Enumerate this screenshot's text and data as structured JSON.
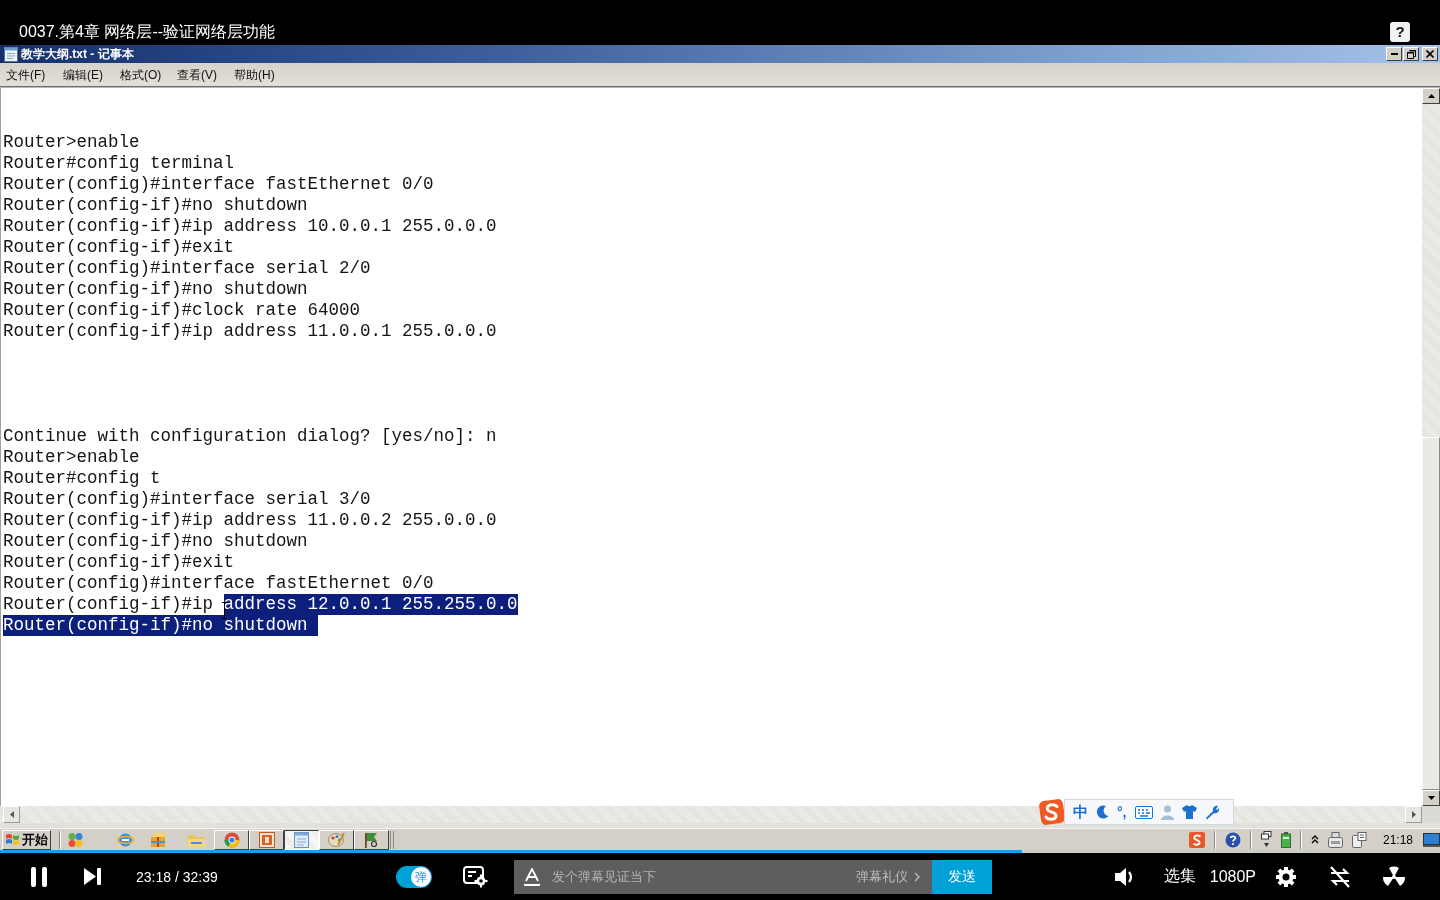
{
  "video": {
    "title": "0037.第4章 网络层--验证网络层功能",
    "help_label": "?"
  },
  "notepad": {
    "title": "教学大纲.txt - 记事本",
    "menu": [
      "文件(F)",
      "编辑(E)",
      "格式(O)",
      "查看(V)",
      "帮助(H)"
    ],
    "blocks": [
      {
        "lines": [
          {
            "parts": [
              {
                "text": "Router>enable",
                "selected": false
              }
            ]
          },
          {
            "parts": [
              {
                "text": "Router#config terminal",
                "selected": false
              }
            ]
          },
          {
            "parts": [
              {
                "text": "Router(config)#interface fastEthernet 0/0",
                "selected": false
              }
            ]
          },
          {
            "parts": [
              {
                "text": "Router(config-if)#no shutdown",
                "selected": false
              }
            ]
          },
          {
            "parts": [
              {
                "text": "Router(config-if)#ip address 10.0.0.1 255.0.0.0",
                "selected": false
              }
            ]
          },
          {
            "parts": [
              {
                "text": "Router(config-if)#exit",
                "selected": false
              }
            ]
          },
          {
            "parts": [
              {
                "text": "Router(config)#interface serial 2/0",
                "selected": false
              }
            ]
          },
          {
            "parts": [
              {
                "text": "Router(config-if)#no shutdown",
                "selected": false
              }
            ]
          },
          {
            "parts": [
              {
                "text": "Router(config-if)#clock rate 64000",
                "selected": false
              }
            ]
          },
          {
            "parts": [
              {
                "text": "Router(config-if)#ip address 11.0.0.1 255.0.0.0",
                "selected": false
              }
            ]
          }
        ]
      },
      {
        "lines": [
          {
            "parts": [
              {
                "text": "Continue with configuration dialog? [yes/no]: n",
                "selected": false
              }
            ]
          },
          {
            "parts": [
              {
                "text": "Router>enable",
                "selected": false
              }
            ]
          },
          {
            "parts": [
              {
                "text": "Router#config t",
                "selected": false
              }
            ]
          },
          {
            "parts": [
              {
                "text": "Router(config)#interface serial 3/0",
                "selected": false
              }
            ]
          },
          {
            "parts": [
              {
                "text": "Router(config-if)#ip address 11.0.0.2 255.0.0.0",
                "selected": false
              }
            ]
          },
          {
            "parts": [
              {
                "text": "Router(config-if)#no shutdown",
                "selected": false
              }
            ]
          },
          {
            "parts": [
              {
                "text": "Router(config-if)#exit",
                "selected": false
              }
            ]
          },
          {
            "parts": [
              {
                "text": "Router(config)#interface fastEthernet 0/0",
                "selected": false
              }
            ]
          },
          {
            "parts": [
              {
                "text": "Router(config-if)#ip ",
                "selected": false
              },
              {
                "text": "address 12.0.0.1 255.255.0.0",
                "selected": true
              }
            ]
          },
          {
            "parts": [
              {
                "text": "Router(config-if)#no shutdown ",
                "selected": true
              }
            ]
          }
        ]
      }
    ]
  },
  "ime_toolbar": {
    "mode": "中",
    "punctuation": "°,"
  },
  "taskbar": {
    "start_label": "开始",
    "tasks": [
      {
        "kind": "browser",
        "selected": false
      },
      {
        "kind": "slides",
        "selected": false
      },
      {
        "kind": "notepad",
        "selected": true
      },
      {
        "kind": "paint",
        "selected": false
      },
      {
        "kind": "tool",
        "selected": false
      }
    ],
    "clock": "21:18"
  },
  "player": {
    "progress": {
      "level": 0.71
    },
    "time": "23:18 / 32:39",
    "danmaku_toggle": {
      "label": "弹",
      "on": true
    },
    "danmaku_input": {
      "placeholder": "发个弹幕见证当下"
    },
    "etiquette_link": "弹幕礼仪",
    "send_button": "发送",
    "episodes": "选集",
    "quality": "1080P"
  }
}
